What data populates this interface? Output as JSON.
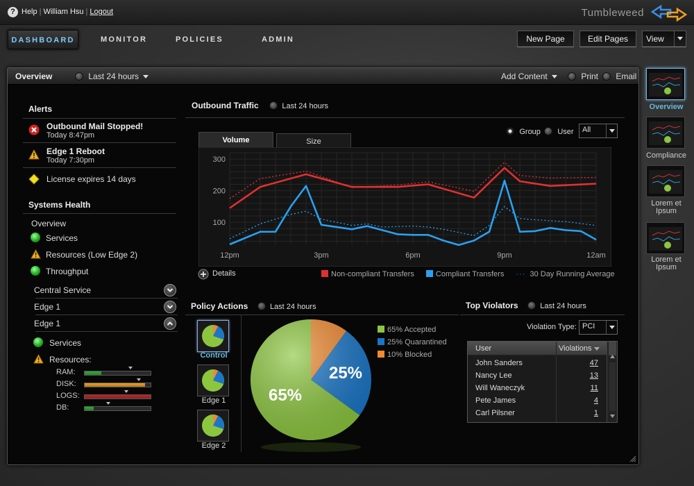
{
  "topbar": {
    "help_icon": "?",
    "help_label": "Help",
    "user": "William Hsu",
    "logout": "Logout",
    "brand": "Tumbleweed"
  },
  "nav": {
    "tabs": [
      "DASHBOARD",
      "MONITOR",
      "POLICIES",
      "ADMIN"
    ],
    "new_page": "New Page",
    "edit_pages": "Edit Pages",
    "view": "View"
  },
  "panel": {
    "title": "Overview",
    "range": "Last 24 hours",
    "add_content": "Add Content",
    "print": "Print",
    "email": "Email"
  },
  "alerts": {
    "title": "Alerts",
    "items": [
      {
        "title": "Outbound Mail Stopped!",
        "time": "Today 8:47pm",
        "icon": "error-icon"
      },
      {
        "title": "Edge 1 Reboot",
        "time": "Today 7:30pm",
        "icon": "warning-icon"
      },
      {
        "title": "License expires 14 days",
        "time": "",
        "icon": "diamond-icon"
      }
    ]
  },
  "systems_health": {
    "title": "Systems Health",
    "overview": "Overview",
    "items": [
      "Services",
      "Resources (Low Edge 2)",
      "Throughput"
    ],
    "groups": [
      "Central Service",
      "Edge 1",
      "Edge 1"
    ],
    "sub_items": [
      "Services",
      "Resources:"
    ],
    "meters": [
      {
        "label": "RAM:",
        "value": 0.25,
        "color": "#2fae2f",
        "marker": 0.68
      },
      {
        "label": "DISK:",
        "value": 0.92,
        "color": "#f0a020",
        "marker": 0.8
      },
      {
        "label": "LOGS:",
        "value": 1.0,
        "color": "#c02020",
        "marker": 0.62
      },
      {
        "label": "DB:",
        "value": 0.14,
        "color": "#2fae2f",
        "marker": 0.35
      }
    ]
  },
  "outbound": {
    "title": "Outbound Traffic",
    "range": "Last 24 hours",
    "tabs": [
      "Volume",
      "Size"
    ],
    "group": "Group",
    "user": "User",
    "select": "All",
    "details": "Details",
    "legend": [
      "Non-compliant Transfers",
      "Compliant Transfers",
      "30 Day Running Average"
    ]
  },
  "chart_data": {
    "type": "line",
    "x": [
      0,
      1,
      2,
      3,
      4,
      5,
      6,
      7,
      8,
      9,
      10,
      11,
      12,
      13,
      14,
      15,
      16,
      17,
      18,
      19,
      20,
      21,
      22,
      23,
      24
    ],
    "x_ticks": [
      {
        "at": 0,
        "label": "12pm"
      },
      {
        "at": 6,
        "label": "3pm"
      },
      {
        "at": 12,
        "label": "6pm"
      },
      {
        "at": 18,
        "label": "9pm"
      },
      {
        "at": 24,
        "label": "12am"
      }
    ],
    "y_ticks": [
      100,
      200,
      300
    ],
    "ylim": [
      30,
      320
    ],
    "series": [
      {
        "name": "Non-compliant Transfers",
        "color": "#e03030",
        "dashed": false,
        "points": [
          [
            0,
            145
          ],
          [
            2,
            212
          ],
          [
            5,
            252
          ],
          [
            8,
            212
          ],
          [
            11,
            212
          ],
          [
            13,
            220
          ],
          [
            16,
            178
          ],
          [
            18,
            272
          ],
          [
            19,
            230
          ],
          [
            21,
            215
          ],
          [
            24,
            222
          ]
        ]
      },
      {
        "name": "",
        "color": "#e03030",
        "dashed": true,
        "points": [
          [
            0,
            175
          ],
          [
            2,
            238
          ],
          [
            5,
            262
          ],
          [
            8,
            210
          ],
          [
            11,
            218
          ],
          [
            13,
            228
          ],
          [
            16,
            198
          ],
          [
            18,
            290
          ],
          [
            19,
            248
          ],
          [
            21,
            240
          ],
          [
            24,
            242
          ]
        ]
      },
      {
        "name": "Compliant Transfers",
        "color": "#2aa0f0",
        "dashed": false,
        "points": [
          [
            0,
            30
          ],
          [
            2,
            70
          ],
          [
            3,
            70
          ],
          [
            4,
            150
          ],
          [
            5,
            215
          ],
          [
            6,
            92
          ],
          [
            8,
            78
          ],
          [
            9,
            88
          ],
          [
            10,
            75
          ],
          [
            11,
            62
          ],
          [
            12,
            60
          ],
          [
            13,
            60
          ],
          [
            14,
            42
          ],
          [
            15,
            28
          ],
          [
            16,
            42
          ],
          [
            17,
            70
          ],
          [
            18,
            232
          ],
          [
            19,
            70
          ],
          [
            20,
            72
          ],
          [
            21,
            82
          ],
          [
            22,
            75
          ],
          [
            23,
            72
          ],
          [
            24,
            45
          ]
        ]
      },
      {
        "name": "",
        "color": "#2aa0f0",
        "dashed": true,
        "points": [
          [
            0,
            48
          ],
          [
            2,
            95
          ],
          [
            4,
            125
          ],
          [
            5,
            135
          ],
          [
            6,
            110
          ],
          [
            8,
            90
          ],
          [
            9,
            95
          ],
          [
            10,
            85
          ],
          [
            12,
            88
          ],
          [
            13,
            85
          ],
          [
            14,
            78
          ],
          [
            16,
            58
          ],
          [
            17,
            90
          ],
          [
            18,
            150
          ],
          [
            19,
            112
          ],
          [
            20,
            108
          ],
          [
            22,
            102
          ],
          [
            24,
            90
          ]
        ]
      }
    ]
  },
  "policy": {
    "title": "Policy Actions",
    "range": "Last 24 hours",
    "thumbs": [
      "Control",
      "Edge 1",
      "Edge 2"
    ],
    "legend": [
      "65% Accepted",
      "25% Quarantined",
      "10% Blocked"
    ],
    "label_big": "65%",
    "label_small": "25%",
    "slices": [
      {
        "name": "Accepted",
        "value": 65,
        "color": "#8cc63f"
      },
      {
        "name": "Quarantined",
        "value": 25,
        "color": "#1a76c8"
      },
      {
        "name": "Blocked",
        "value": 10,
        "color": "#f08a30"
      }
    ]
  },
  "violators": {
    "title": "Top Violators",
    "range": "Last 24 hours",
    "type_label": "Violation Type:",
    "type_value": "PCI",
    "columns": [
      "User",
      "Violations"
    ],
    "rows": [
      {
        "user": "John Sanders",
        "count": "47"
      },
      {
        "user": "Nancy Lee",
        "count": "13"
      },
      {
        "user": "Will Waneczyk",
        "count": "11"
      },
      {
        "user": "Pete James",
        "count": "4"
      },
      {
        "user": "Carl Pilsner",
        "count": "1"
      }
    ]
  },
  "pages": [
    "Overview",
    "Compliance",
    "Lorem et Ipsum",
    "Lorem et Ipsum"
  ]
}
